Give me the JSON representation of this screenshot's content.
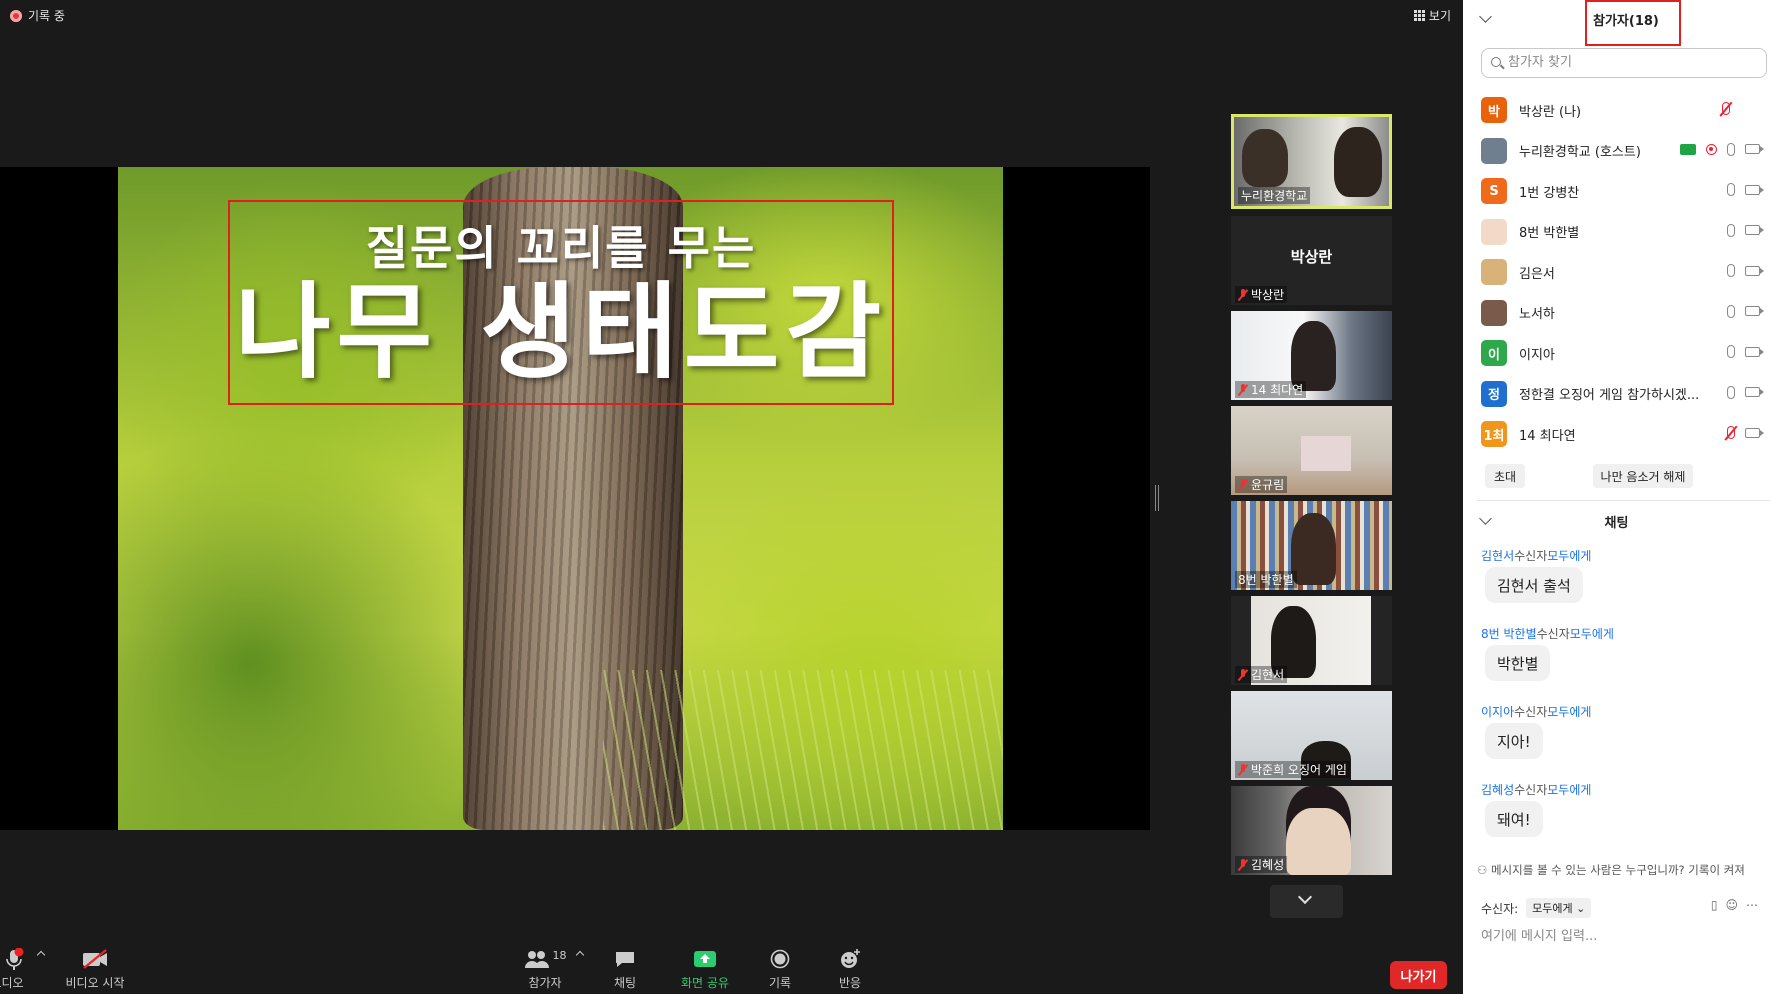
{
  "top": {
    "recording": "기록 중",
    "view": "보기"
  },
  "slide": {
    "subtitle": "질문의 꼬리를 무는",
    "title": "나무 생태도감"
  },
  "thumbs": [
    {
      "name": "누리환경학교",
      "muted": false
    },
    {
      "name": "박상란",
      "muted": true,
      "avatar_text": "박상란"
    },
    {
      "name": "14 최다연",
      "muted": true
    },
    {
      "name": "윤규림",
      "muted": true
    },
    {
      "name": "8번 박한별",
      "muted": false
    },
    {
      "name": "김현서",
      "muted": true
    },
    {
      "name": "박준희 오징어 게임",
      "muted": true
    },
    {
      "name": "김혜성",
      "muted": true
    }
  ],
  "toolbar": {
    "audio": "오디오",
    "video": "비디오 시작",
    "participants": "참가자",
    "participants_count": "18",
    "chat": "채팅",
    "share": "화면 공유",
    "record": "기록",
    "reactions": "반응",
    "leave": "나가기"
  },
  "sidebar": {
    "title": "참가자(18)",
    "search_placeholder": "참가자 찾기",
    "participants": [
      {
        "avatar": "박",
        "color": "#e8620c",
        "name": "박상란 (나)",
        "mic": "off",
        "cam": false
      },
      {
        "avatar": "",
        "color": "#6f7f8f",
        "name": "누리환경학교 (호스트)",
        "mic": "on",
        "cam": true,
        "sharing": true,
        "recording": true
      },
      {
        "avatar": "S",
        "color": "#f06a1c",
        "name": "1번 강병찬",
        "mic": "on",
        "cam": true
      },
      {
        "avatar": "",
        "color": "#f3d9c7",
        "name": "8번 박한별",
        "mic": "on",
        "cam": true
      },
      {
        "avatar": "",
        "color": "#d9b27a",
        "name": "김은서",
        "mic": "on",
        "cam": true
      },
      {
        "avatar": "",
        "color": "#7a5a4a",
        "name": "노서하",
        "mic": "on",
        "cam": true
      },
      {
        "avatar": "이",
        "color": "#2ea84a",
        "name": "이지아",
        "mic": "on",
        "cam": true
      },
      {
        "avatar": "정",
        "color": "#1f6fd1",
        "name": "정한결 오징어 게임 참가하시겠...",
        "mic": "on",
        "cam": true
      },
      {
        "avatar": "1최",
        "color": "#f0961c",
        "name": "14 최다연",
        "mic": "off",
        "cam": true
      }
    ],
    "invite": "초대",
    "unmute_me": "나만 음소거 해제",
    "chat_title": "채팅",
    "messages": [
      {
        "sender": "김현서",
        "recv": "수신자",
        "to": "모두에게",
        "text": "김현서 출석"
      },
      {
        "sender": "8번 박한별",
        "recv": "수신자",
        "to": "모두에게",
        "text": "박한별"
      },
      {
        "sender": "이지아",
        "recv": "수신자",
        "to": "모두에게",
        "text": "지아!"
      },
      {
        "sender": "김혜성",
        "recv": "수신자",
        "to": "모두에게",
        "text": "돼여!"
      }
    ],
    "notice": "메시지를 볼 수 있는 사람은 누구입니까? 기록이 켜져",
    "recipient_label": "수신자:",
    "recipient_value": "모두에게",
    "input_placeholder": "여기에 메시지 입력..."
  }
}
